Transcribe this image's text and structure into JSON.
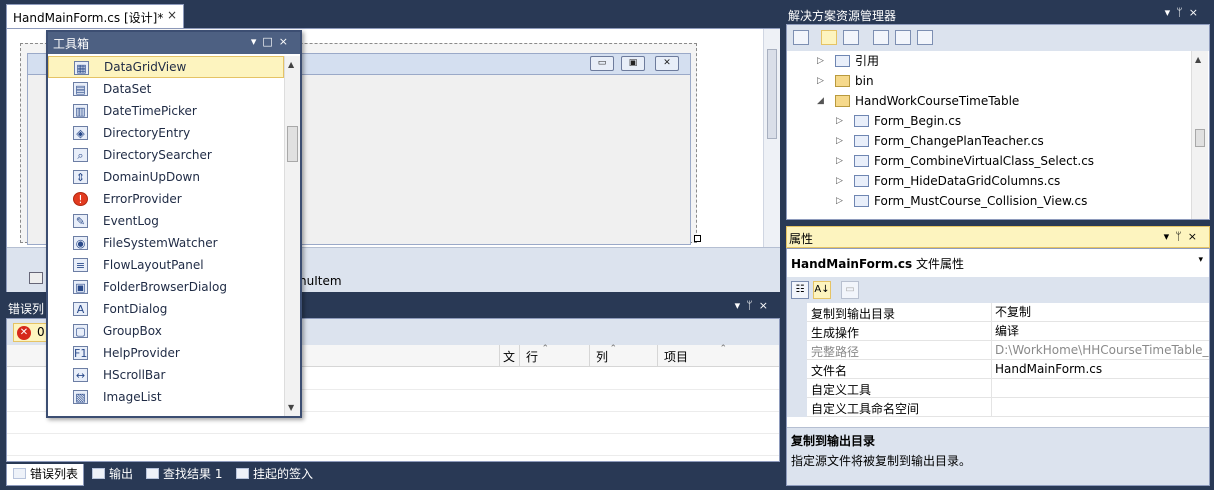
{
  "document_tab": {
    "title": "HandMainForm.cs [设计]*",
    "close": "×"
  },
  "designer": {
    "tray_item": "nuItem",
    "form_buttons": {
      "minimize": "▭",
      "maximize": "▣",
      "close": "✕"
    }
  },
  "toolbox": {
    "title": "工具箱",
    "buttons": {
      "dropdown": "▾",
      "restore": "□",
      "close": "×"
    },
    "items": [
      {
        "label": "DataGridView",
        "icon": "datagrid-icon",
        "glyph": "▦",
        "selected": true
      },
      {
        "label": "DataSet",
        "icon": "dataset-icon",
        "glyph": "▤"
      },
      {
        "label": "DateTimePicker",
        "icon": "calendar-icon",
        "glyph": "▥"
      },
      {
        "label": "DirectoryEntry",
        "icon": "directory-entry-icon",
        "glyph": "◈"
      },
      {
        "label": "DirectorySearcher",
        "icon": "directory-searcher-icon",
        "glyph": "⌕"
      },
      {
        "label": "DomainUpDown",
        "icon": "updown-icon",
        "glyph": "⇕"
      },
      {
        "label": "ErrorProvider",
        "icon": "error-provider-icon",
        "glyph": "!",
        "round": true
      },
      {
        "label": "EventLog",
        "icon": "eventlog-icon",
        "glyph": "✎"
      },
      {
        "label": "FileSystemWatcher",
        "icon": "filewatcher-icon",
        "glyph": "◉"
      },
      {
        "label": "FlowLayoutPanel",
        "icon": "flowlayout-icon",
        "glyph": "≡"
      },
      {
        "label": "FolderBrowserDialog",
        "icon": "folder-dialog-icon",
        "glyph": "▣"
      },
      {
        "label": "FontDialog",
        "icon": "font-dialog-icon",
        "glyph": "A"
      },
      {
        "label": "GroupBox",
        "icon": "groupbox-icon",
        "glyph": "▢"
      },
      {
        "label": "HelpProvider",
        "icon": "help-provider-icon",
        "glyph": "F1"
      },
      {
        "label": "HScrollBar",
        "icon": "hscrollbar-icon",
        "glyph": "↔"
      },
      {
        "label": "ImageList",
        "icon": "imagelist-icon",
        "glyph": "▧"
      }
    ]
  },
  "error_list": {
    "title": "错误列",
    "panel_buttons": {
      "dropdown": "▾",
      "pin": "ᛘ",
      "close": "×"
    },
    "error_count": "0",
    "error_glyph": "✕",
    "columns": {
      "file": "文",
      "line": "行",
      "column": "列",
      "project": "项目"
    },
    "sort_glyph": "⌃"
  },
  "bottom_tabs": [
    {
      "label": "错误列表",
      "icon": "error-list-icon",
      "active": true
    },
    {
      "label": "输出",
      "icon": "output-icon"
    },
    {
      "label": "查找结果 1",
      "icon": "find-results-icon"
    },
    {
      "label": "挂起的签入",
      "icon": "pending-checkin-icon"
    }
  ],
  "solution_explorer": {
    "title": "解决方案资源管理器",
    "panel_buttons": {
      "dropdown": "▾",
      "pin": "ᛘ",
      "close": "×"
    },
    "tree": [
      {
        "label": "引用",
        "depth": 0,
        "expander": "▷",
        "icon": "references-icon"
      },
      {
        "label": "bin",
        "depth": 0,
        "expander": "▷",
        "icon": "folder-icon",
        "folder": true
      },
      {
        "label": "HandWorkCourseTimeTable",
        "depth": 0,
        "expander": "◢",
        "icon": "folder-open-icon",
        "folder": true
      },
      {
        "label": "Form_Begin.cs",
        "depth": 1,
        "expander": "▷",
        "icon": "form-file-icon"
      },
      {
        "label": "Form_ChangePlanTeacher.cs",
        "depth": 1,
        "expander": "▷",
        "icon": "form-file-icon"
      },
      {
        "label": "Form_CombineVirtualClass_Select.cs",
        "depth": 1,
        "expander": "▷",
        "icon": "form-file-icon"
      },
      {
        "label": "Form_HideDataGridColumns.cs",
        "depth": 1,
        "expander": "▷",
        "icon": "form-file-icon"
      },
      {
        "label": "Form_MustCourse_Collision_View.cs",
        "depth": 1,
        "expander": "▷",
        "icon": "form-file-icon"
      }
    ]
  },
  "properties": {
    "title": "属性",
    "panel_buttons": {
      "dropdown": "▾",
      "pin": "ᛘ",
      "close": "×"
    },
    "object_name": "HandMainForm.cs",
    "object_type": "文件属性",
    "dropdown_glyph": "▾",
    "toolbar": {
      "categorized": "☷",
      "alphabetical": "A↓",
      "property_pages": "▭"
    },
    "rows": [
      {
        "name": "复制到输出目录",
        "value": "不复制"
      },
      {
        "name": "生成操作",
        "value": "编译"
      },
      {
        "name": "完整路径",
        "value": "D:\\WorkHome\\HHCourseTimeTable_",
        "dim": true
      },
      {
        "name": "文件名",
        "value": "HandMainForm.cs"
      },
      {
        "name": "自定义工具",
        "value": ""
      },
      {
        "name": "自定义工具命名空间",
        "value": ""
      }
    ],
    "description": {
      "title": "复制到输出目录",
      "text": "指定源文件将被复制到输出目录。"
    }
  },
  "colors": {
    "chrome": "#293955",
    "highlight": "#fdf4bf",
    "panel_title": "#4d6082"
  }
}
